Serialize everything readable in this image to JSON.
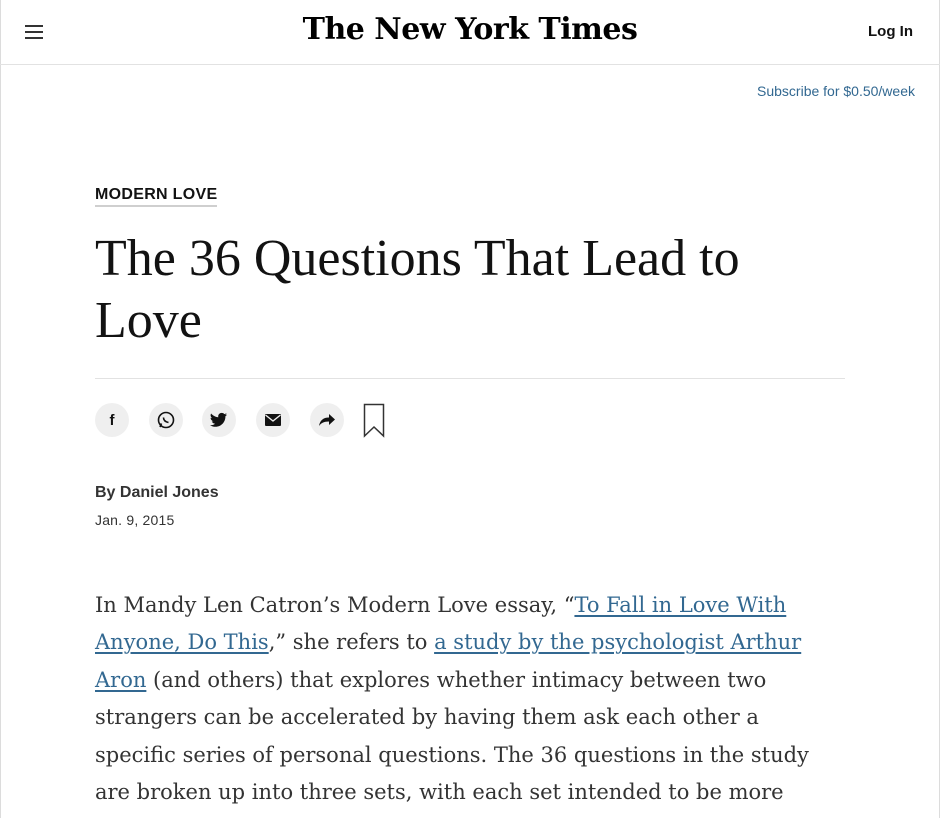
{
  "header": {
    "menu_icon": "hamburger-menu-icon",
    "logo_text": "The New York Times",
    "login_label": "Log In"
  },
  "subscribe_label": "Subscribe for $0.50/week",
  "article": {
    "kicker": "MODERN LOVE",
    "headline": "The 36 Questions That Lead to Love",
    "share_icons": [
      "facebook-icon",
      "whatsapp-icon",
      "twitter-icon",
      "email-icon",
      "share-icon",
      "bookmark-icon"
    ],
    "byline": "By Daniel Jones",
    "date": "Jan. 9, 2015",
    "body": {
      "t1": "In Mandy Len Catron’s Modern Love essay, “",
      "link1": "To Fall in Love With Anyone, Do This",
      "t2": ",” she refers to ",
      "link2": "a study by the psychologist Arthur Aron",
      "t3": " (and others) that explores whether intimacy between two strangers can be accelerated by having them ask each other a specific series of personal questions. The 36 questions in the study are broken up into three sets, with each set intended to be more"
    }
  },
  "colors": {
    "link": "#326891",
    "text": "#121212",
    "body_text": "#333333",
    "divider": "#e2e2e2"
  }
}
